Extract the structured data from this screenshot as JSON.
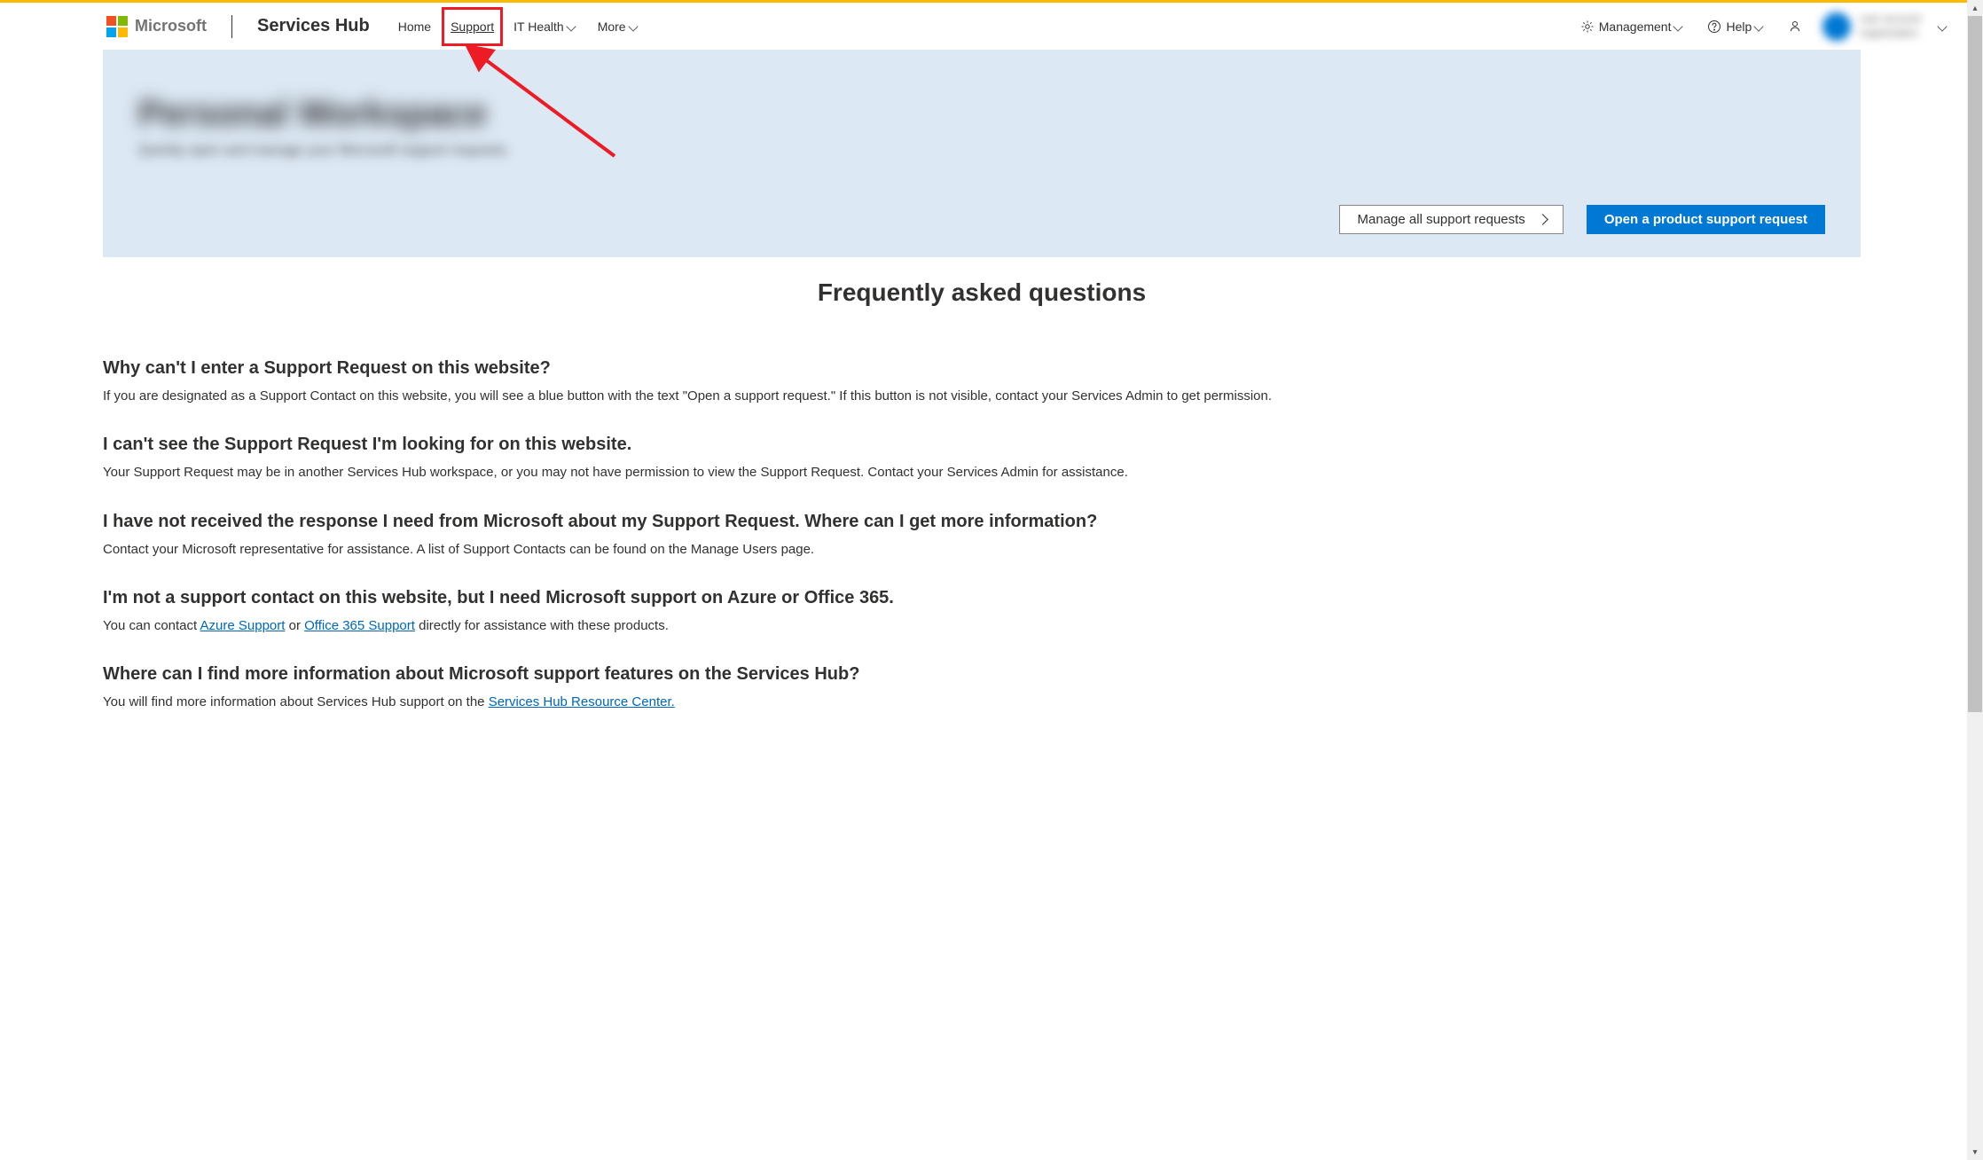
{
  "header": {
    "brand": "Microsoft",
    "product": "Services Hub",
    "nav": {
      "home": "Home",
      "support": "Support",
      "ithealth": "IT Health",
      "more": "More",
      "management": "Management",
      "help": "Help"
    },
    "user": {
      "line1": "user account",
      "line2": "organization"
    }
  },
  "banner": {
    "title": "Personal Workspace",
    "subtitle": "Quickly open and manage your Microsoft support requests.",
    "manage_btn": "Manage all support requests",
    "open_btn": "Open a product support request"
  },
  "faq": {
    "heading": "Frequently asked questions",
    "items": [
      {
        "q": "Why can't I enter a Support Request on this website?",
        "a_pre": "If you are designated as a Support Contact on this website, you will see a blue button with the text \"Open a support request.\" If this button is not visible, contact your Services Admin to get permission."
      },
      {
        "q": "I can't see the Support Request I'm looking for on this website.",
        "a_pre": "Your Support Request may be in another Services Hub workspace, or you may not have permission to view the Support Request. Contact your Services Admin for assistance."
      },
      {
        "q": "I have not received the response I need from Microsoft about my Support Request. Where can I get more information?",
        "a_pre": "Contact your Microsoft representative for assistance. A list of Support Contacts can be found on the Manage Users page."
      },
      {
        "q": "I'm not a support contact on this website, but I need Microsoft support on Azure or Office 365.",
        "a_pre": "You can contact ",
        "link1": "Azure Support",
        "a_mid": " or ",
        "link2": "Office 365 Support",
        "a_post": " directly for assistance with these products."
      },
      {
        "q": "Where can I find more information about Microsoft support features on the Services Hub?",
        "a_pre": "You will find more information about Services Hub support on the ",
        "link1": "Services Hub Resource Center."
      }
    ]
  },
  "annotation": {
    "highlight_target": "support-nav",
    "arrow_color": "#ed1c24"
  }
}
